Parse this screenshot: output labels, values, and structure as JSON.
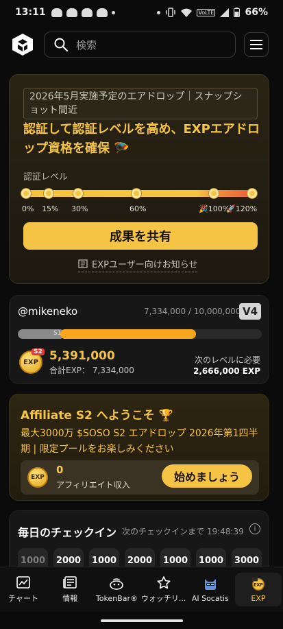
{
  "status_bar": {
    "time": "13:11",
    "battery": "66%",
    "volte": "VoLTE"
  },
  "header": {
    "search_placeholder": "検索"
  },
  "exp_card": {
    "tag": "2026年5月実施予定のエアドロップ｜スナップショット間近",
    "title": "認証して認証レベルを高め、EXPエアドロップ資格を確保 🪂",
    "level_label": "認証レベル",
    "ticks": [
      {
        "label": "0%",
        "value": 0
      },
      {
        "label": "15%",
        "value": 15
      },
      {
        "label": "30%",
        "value": 30
      },
      {
        "label": "60%",
        "value": 60
      },
      {
        "label": "🎉100%",
        "value": 100
      },
      {
        "label": "🚀120%",
        "value": 120
      }
    ],
    "share_button": "成果を共有",
    "notice": "EXPユーザー向けお知らせ"
  },
  "user_card": {
    "username": "@mikeneko",
    "progress": "7,334,000 / 10,000,000",
    "level_badge": "V4",
    "bar_label": "S1",
    "exp_badge": "S2",
    "exp_coin_label": "EXP",
    "exp_amount": "5,391,000",
    "exp_total": "合計EXP： 7,334,000",
    "need_label": "次のレベルに必要",
    "need_value": "2,666,000 EXP"
  },
  "affiliate_card": {
    "title": "Affiliate S2 へようこそ 🏆",
    "body": "最大3000万 $SOSO S2 エアドロップ 2026年第1四半期 | 限定プールをお楽しみください",
    "coin_label": "EXP",
    "amount": "0",
    "amount_label": "アフィリエイト収入",
    "start_button": "始めましょう"
  },
  "checkin_card": {
    "title": "毎日のチェックイン",
    "next": "次のチェックインまで 19:48:39",
    "days": [
      "1000",
      "2000",
      "1000",
      "2000",
      "1000",
      "1000",
      "3000"
    ]
  },
  "bottom_nav": [
    {
      "label": "チャート",
      "icon": "chart-icon"
    },
    {
      "label": "情報",
      "icon": "news-icon"
    },
    {
      "label": "TokenBar®",
      "icon": "tokenbar-icon"
    },
    {
      "label": "ウォッチリ...",
      "icon": "star-icon"
    },
    {
      "label": "AI Socatis",
      "icon": "ai-cat-icon"
    },
    {
      "label": "EXP",
      "icon": "exp-icon"
    }
  ],
  "colors": {
    "accent": "#f6c445",
    "orange": "#f7a61d",
    "background": "#0b0b0b"
  }
}
